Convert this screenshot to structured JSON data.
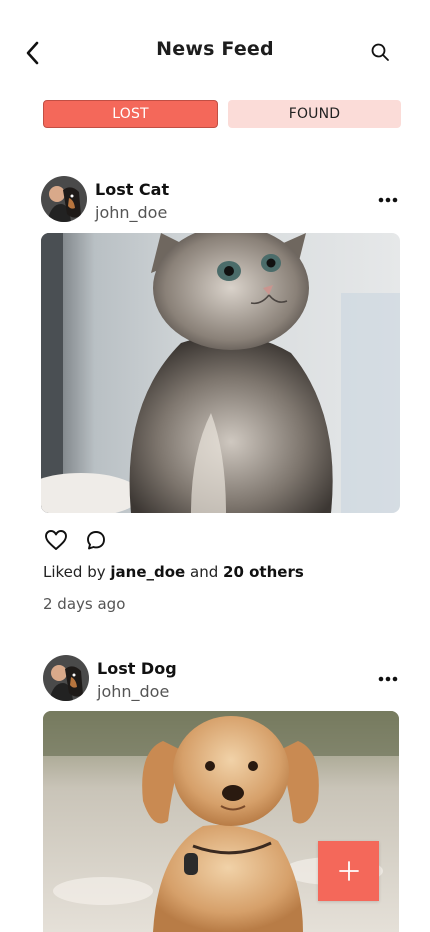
{
  "header": {
    "title": "News Feed",
    "back_icon": "chevron-left-icon",
    "search_icon": "search-icon"
  },
  "tabs": [
    {
      "label": "LOST",
      "active": true
    },
    {
      "label": "FOUND",
      "active": false
    }
  ],
  "colors": {
    "accent": "#f4685a",
    "accent_light": "#fbdcd8"
  },
  "posts": [
    {
      "title": "Lost Cat",
      "username": "john_doe",
      "liked_prefix": "Liked by",
      "liked_user": "jane_doe",
      "liked_and": "and",
      "liked_others": "20 others",
      "time": "2 days ago"
    },
    {
      "title": "Lost Dog",
      "username": "john_doe"
    }
  ],
  "fab": {
    "icon": "plus-icon"
  }
}
